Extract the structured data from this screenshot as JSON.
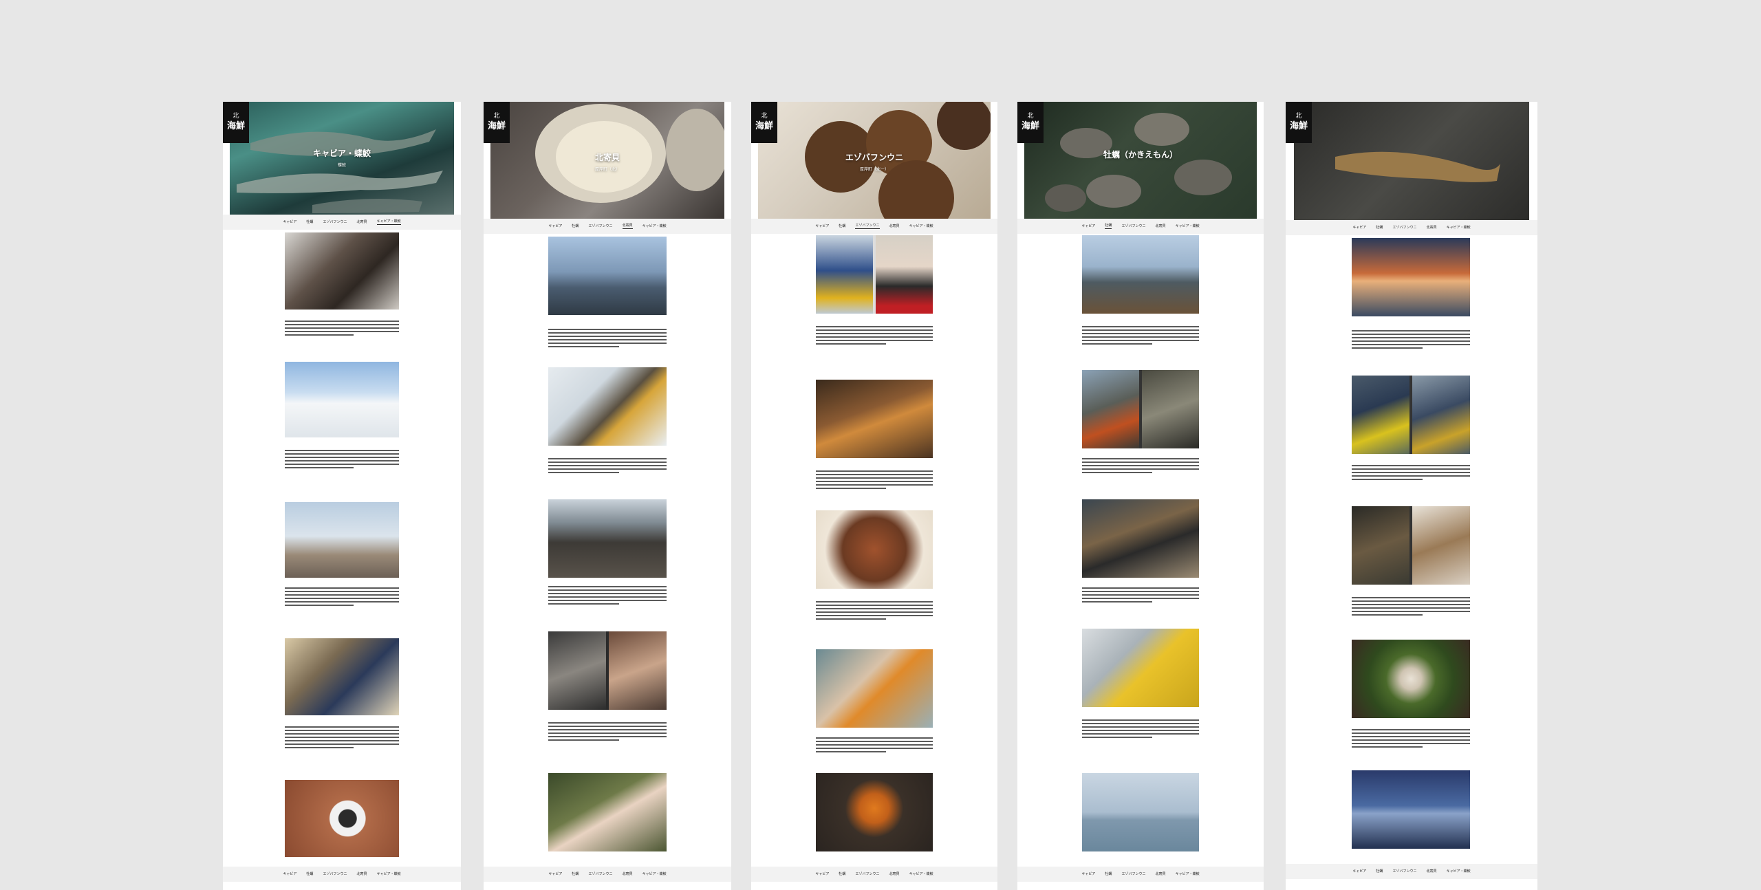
{
  "nav_items": [
    "",
    "",
    "",
    "",
    "",
    "",
    ""
  ],
  "tabs": [
    {
      "label": "キャビア",
      "sub": ""
    },
    {
      "label": "牡蠣",
      "sub": ""
    },
    {
      "label": "エゾバフンウニ",
      "sub": ""
    },
    {
      "label": "北寄貝",
      "sub": ""
    },
    {
      "label": "キャビア・蝶鮫",
      "sub": ""
    }
  ],
  "logo": {
    "top": "北",
    "big": "海鮮"
  },
  "pages": [
    {
      "title": "キャビア・蝶鮫",
      "subtitle": "蝶鮫"
    },
    {
      "title": "北寄貝",
      "subtitle": "厚岸町（北）"
    },
    {
      "title": "エゾバフンウニ",
      "subtitle": "厚岸町（北一）"
    },
    {
      "title": "牡蠣（かきえもん）",
      "subtitle": ""
    },
    {
      "title": "",
      "subtitle": ""
    }
  ],
  "colors": {
    "background": "#e7e7e7",
    "page": "#ffffff",
    "tab_bar": "#f2f2f2",
    "logo": "#111111"
  }
}
